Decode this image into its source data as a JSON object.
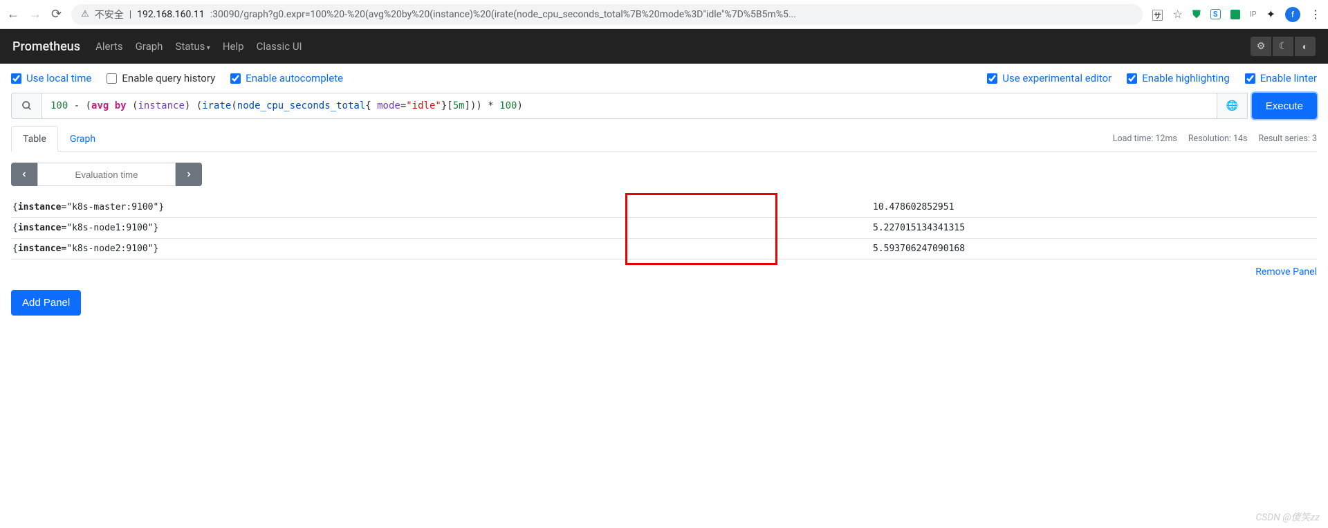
{
  "browser": {
    "insecure_label": "不安全",
    "url_host": "192.168.160.11",
    "url_port_path": ":30090/graph?g0.expr=100%20-%20(avg%20by%20(instance)%20(irate(node_cpu_seconds_total%7B%20mode%3D\"idle\"%7D%5B5m%5...",
    "avatar_letter": "f"
  },
  "nav": {
    "brand": "Prometheus",
    "links": [
      "Alerts",
      "Graph",
      "Status",
      "Help",
      "Classic UI"
    ]
  },
  "options": {
    "use_local_time": "Use local time",
    "enable_query_history": "Enable query history",
    "enable_autocomplete": "Enable autocomplete",
    "use_experimental_editor": "Use experimental editor",
    "enable_highlighting": "Enable highlighting",
    "enable_linter": "Enable linter"
  },
  "query": {
    "tokens": {
      "n100a": "100",
      "minus": " - (",
      "avg": "avg",
      "by": " by ",
      "paren_open": "(",
      "instance": "instance",
      "paren_close": ") (",
      "irate": "irate",
      "paren_open2": "(",
      "metric": "node_cpu_seconds_total",
      "brace_open": "{ ",
      "mode_key": "mode",
      "eq": "=",
      "mode_val": "\"idle\"",
      "brace_close": "}",
      "range_open": "[",
      "dur": "5m",
      "range_close": "])) * ",
      "n100b": "100",
      "tail": ")"
    },
    "execute": "Execute"
  },
  "tabs": {
    "table": "Table",
    "graph": "Graph"
  },
  "stats": {
    "load": "Load time: 12ms",
    "res": "Resolution: 14s",
    "series": "Result series: 3"
  },
  "eval": {
    "placeholder": "Evaluation time"
  },
  "results": [
    {
      "label_key": "instance",
      "label_val": "k8s-master:9100",
      "value": "10.478602852951"
    },
    {
      "label_key": "instance",
      "label_val": "k8s-node1:9100",
      "value": "5.227015134341315"
    },
    {
      "label_key": "instance",
      "label_val": "k8s-node2:9100",
      "value": "5.593706247090168"
    }
  ],
  "panel": {
    "remove": "Remove Panel",
    "add": "Add Panel"
  },
  "watermark": "CSDN @傻笑zz"
}
